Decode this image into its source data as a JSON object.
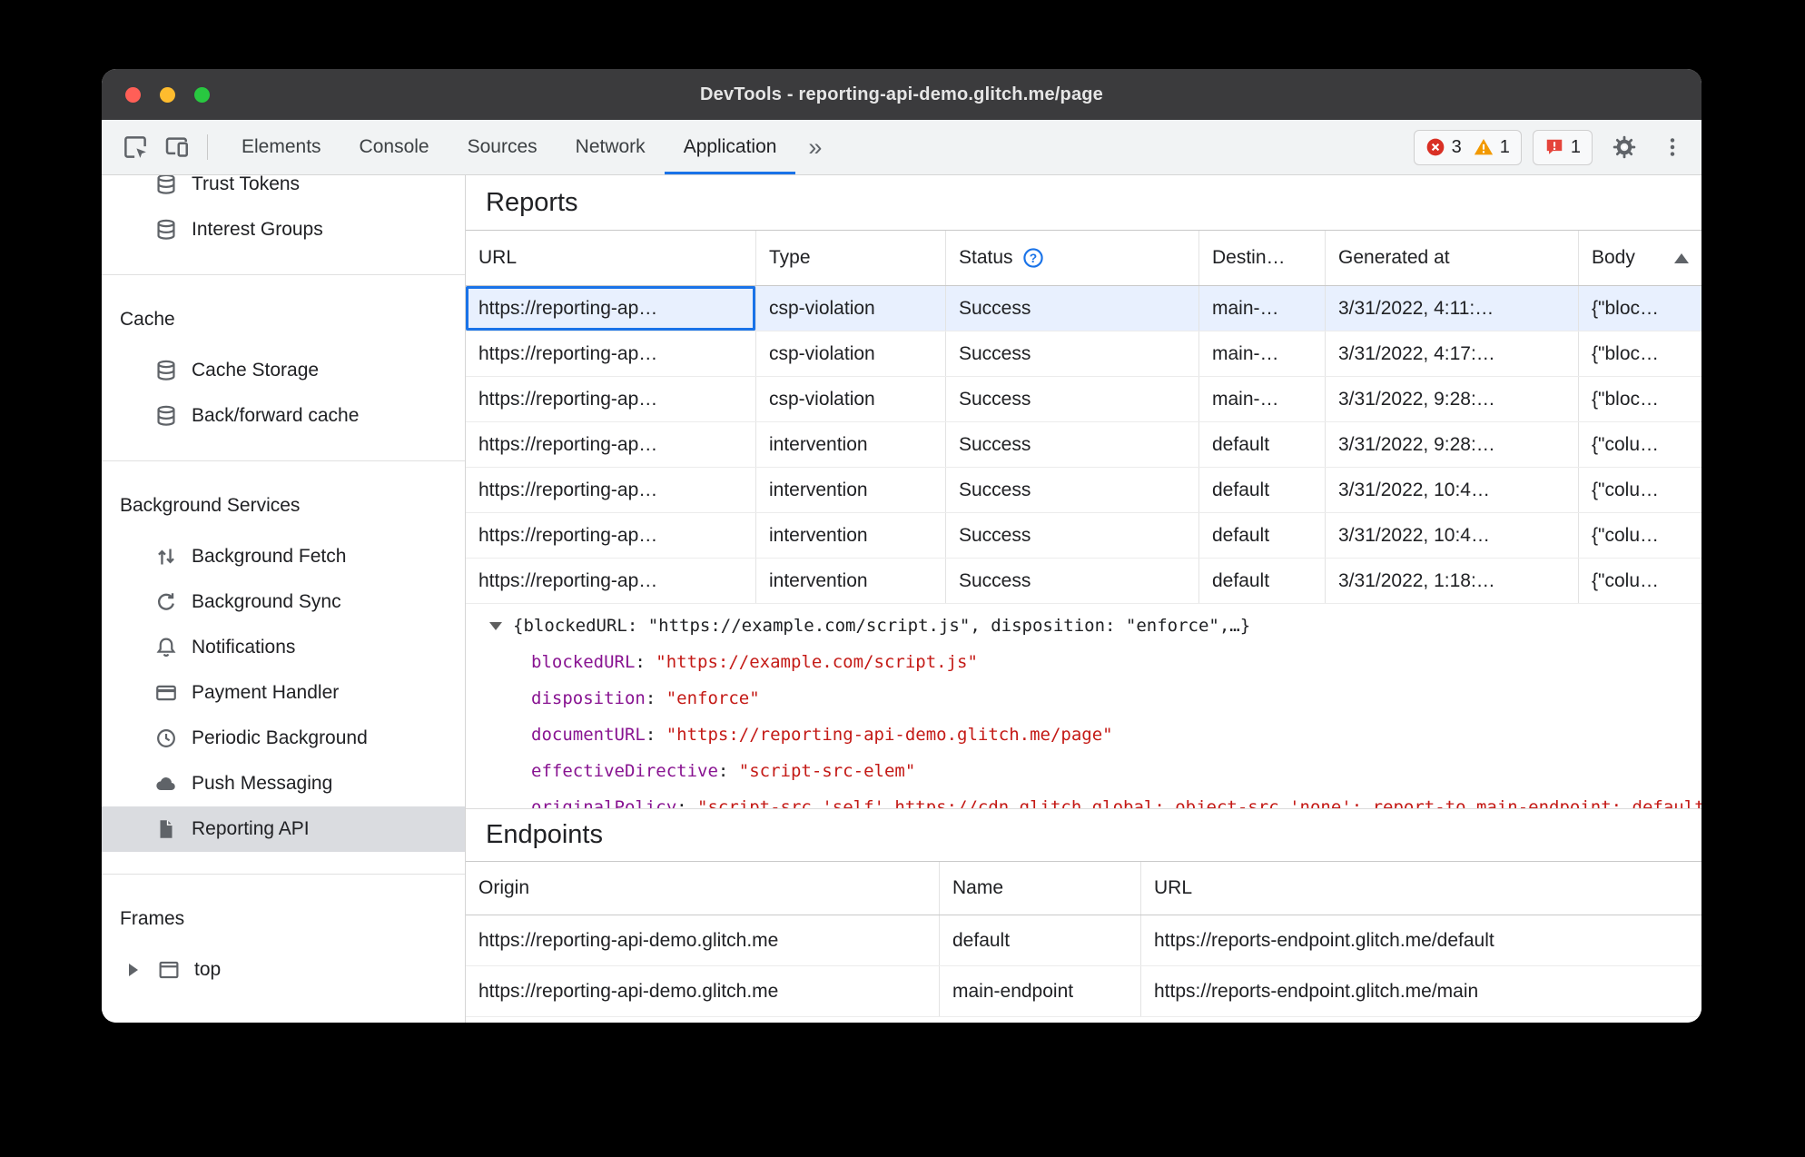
{
  "window": {
    "title": "DevTools - reporting-api-demo.glitch.me/page"
  },
  "toolbar": {
    "tabs": [
      {
        "label": "Elements",
        "selected": false
      },
      {
        "label": "Console",
        "selected": false
      },
      {
        "label": "Sources",
        "selected": false
      },
      {
        "label": "Network",
        "selected": false
      },
      {
        "label": "Application",
        "selected": true
      }
    ],
    "more_tabs": "»",
    "badges": {
      "errors": "3",
      "warnings": "1",
      "issues": "1"
    }
  },
  "icons": {
    "toolbar": [
      "inspect-cursor-icon",
      "device-toolbar-icon",
      "error-circle-icon",
      "warning-triangle-icon",
      "issues-icon",
      "settings-gear-icon",
      "kebab-menu-icon"
    ],
    "sidebar": [
      "database-icon",
      "background-fetch-arrows-icon",
      "background-sync-icon",
      "notifications-bell-icon",
      "payment-card-icon",
      "periodic-clock-icon",
      "push-cloud-icon",
      "reporting-file-icon",
      "frame-icon"
    ],
    "table": [
      "help-circle-icon",
      "sort-ascending-icon",
      "disclosure-triangle-icon"
    ]
  },
  "colors": {
    "accent_blue": "#1a73e8",
    "titlebar": "#3b3b3d",
    "toolbar_bg": "#f1f3f4",
    "selection_gray": "#dadce0",
    "selected_row_blue": "#e8f0fe",
    "error_red": "#d93025",
    "warning_orange": "#f29900",
    "json_key_purple": "#881391",
    "json_string_red": "#c41a16",
    "traffic_red": "#ff5f57",
    "traffic_yellow": "#febc2e",
    "traffic_green": "#28c840"
  },
  "sidebar": {
    "sections": [
      {
        "title": "",
        "items": [
          {
            "label": "Trust Tokens",
            "icon": "database-icon"
          },
          {
            "label": "Interest Groups",
            "icon": "database-icon"
          }
        ]
      },
      {
        "title": "Cache",
        "items": [
          {
            "label": "Cache Storage",
            "icon": "database-icon"
          },
          {
            "label": "Back/forward cache",
            "icon": "database-icon"
          }
        ]
      },
      {
        "title": "Background Services",
        "items": [
          {
            "label": "Background Fetch",
            "icon": "background-fetch-arrows-icon"
          },
          {
            "label": "Background Sync",
            "icon": "background-sync-icon"
          },
          {
            "label": "Notifications",
            "icon": "notifications-bell-icon"
          },
          {
            "label": "Payment Handler",
            "icon": "payment-card-icon"
          },
          {
            "label": "Periodic Background",
            "icon": "periodic-clock-icon"
          },
          {
            "label": "Push Messaging",
            "icon": "push-cloud-icon"
          },
          {
            "label": "Reporting API",
            "icon": "reporting-file-icon",
            "selected": true
          }
        ]
      },
      {
        "title": "Frames",
        "items": [
          {
            "label": "top",
            "icon": "frame-icon"
          }
        ]
      }
    ]
  },
  "reports": {
    "title": "Reports",
    "columns": [
      "URL",
      "Type",
      "Status",
      "Destin…",
      "Generated at",
      "Body"
    ],
    "rows": [
      {
        "url": "https://reporting-ap…",
        "type": "csp-violation",
        "status": "Success",
        "destination": "main-…",
        "generated": "3/31/2022, 4:11:…",
        "body": "{\"bloc…",
        "selected": true
      },
      {
        "url": "https://reporting-ap…",
        "type": "csp-violation",
        "status": "Success",
        "destination": "main-…",
        "generated": "3/31/2022, 4:17:…",
        "body": "{\"bloc…"
      },
      {
        "url": "https://reporting-ap…",
        "type": "csp-violation",
        "status": "Success",
        "destination": "main-…",
        "generated": "3/31/2022, 9:28:…",
        "body": "{\"bloc…"
      },
      {
        "url": "https://reporting-ap…",
        "type": "intervention",
        "status": "Success",
        "destination": "default",
        "generated": "3/31/2022, 9:28:…",
        "body": "{\"colu…"
      },
      {
        "url": "https://reporting-ap…",
        "type": "intervention",
        "status": "Success",
        "destination": "default",
        "generated": "3/31/2022, 10:4…",
        "body": "{\"colu…"
      },
      {
        "url": "https://reporting-ap…",
        "type": "intervention",
        "status": "Success",
        "destination": "default",
        "generated": "3/31/2022, 10:4…",
        "body": "{\"colu…"
      },
      {
        "url": "https://reporting-ap…",
        "type": "intervention",
        "status": "Success",
        "destination": "default",
        "generated": "3/31/2022, 1:18:…",
        "body": "{\"colu…"
      }
    ]
  },
  "preview": {
    "summary": "{blockedURL: \"https://example.com/script.js\", disposition: \"enforce\",…}",
    "properties": [
      {
        "key": "blockedURL",
        "value": "\"https://example.com/script.js\""
      },
      {
        "key": "disposition",
        "value": "\"enforce\""
      },
      {
        "key": "documentURL",
        "value": "\"https://reporting-api-demo.glitch.me/page\""
      },
      {
        "key": "effectiveDirective",
        "value": "\"script-src-elem\""
      }
    ],
    "clipped": {
      "key": "originalPolicy",
      "value": "\"script-src 'self' https://cdn.glitch.global; object-src 'none'; report-to main-endpoint; default-src 'self'\""
    }
  },
  "endpoints": {
    "title": "Endpoints",
    "columns": [
      "Origin",
      "Name",
      "URL"
    ],
    "rows": [
      {
        "origin": "https://reporting-api-demo.glitch.me",
        "name": "default",
        "url": "https://reports-endpoint.glitch.me/default"
      },
      {
        "origin": "https://reporting-api-demo.glitch.me",
        "name": "main-endpoint",
        "url": "https://reports-endpoint.glitch.me/main"
      }
    ]
  }
}
